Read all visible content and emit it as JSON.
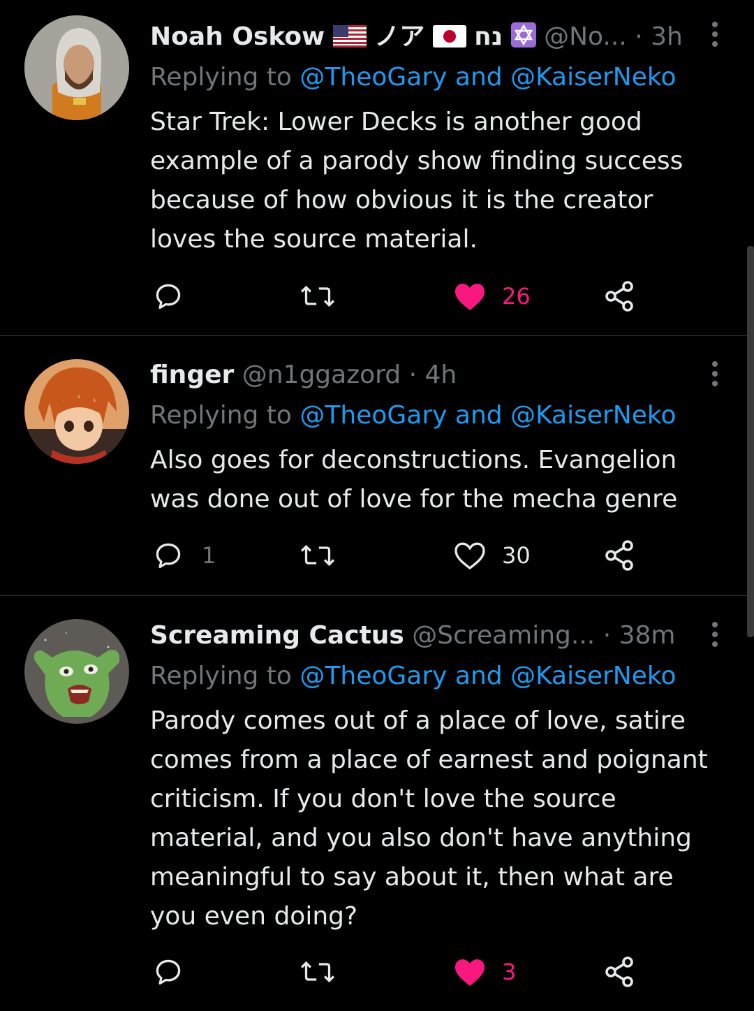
{
  "tweets": [
    {
      "name": "Noah Oskow",
      "handle": "@No...",
      "time": "3h",
      "replying_prefix": "Replying to ",
      "replying_to": "@TheoGary and @KaiserNeko",
      "text": "Star Trek: Lower Decks is another good example of a parody show finding success because of how obvious it is the creator loves the source material.",
      "reply_count": "",
      "retweet_count": "",
      "like_count": "26",
      "liked": true,
      "name_suffix_text": "ノア",
      "name_suffix_hebrew": "נח"
    },
    {
      "name": "finger",
      "handle": "@n1ggazord",
      "time": "4h",
      "replying_prefix": "Replying to ",
      "replying_to": "@TheoGary and @KaiserNeko",
      "text": "Also goes for deconstructions. Evangelion was done out of love for the mecha genre",
      "reply_count": "1",
      "retweet_count": "",
      "like_count": "30",
      "liked": false
    },
    {
      "name": "Screaming Cactus",
      "handle": "@Screaming...",
      "time": "38m",
      "replying_prefix": "Replying to ",
      "replying_to": "@TheoGary and @KaiserNeko",
      "text": "Parody comes out of a place of love, satire comes from a place of earnest and poignant criticism. If you don't love the source material, and you also don't have anything meaningful to say about it, then what are you even doing?",
      "reply_count": "",
      "retweet_count": "",
      "like_count": "3",
      "liked": true
    }
  ],
  "separator": "·",
  "colors": {
    "background": "#000000",
    "text": "#e7e9ea",
    "muted": "#71767b",
    "link": "#1d9bf0",
    "like": "#f91880",
    "divider": "#2f3336"
  },
  "icons": {
    "reply": "reply-icon",
    "retweet": "retweet-icon",
    "like": "heart-icon",
    "share": "share-icon",
    "more": "more-icon"
  }
}
